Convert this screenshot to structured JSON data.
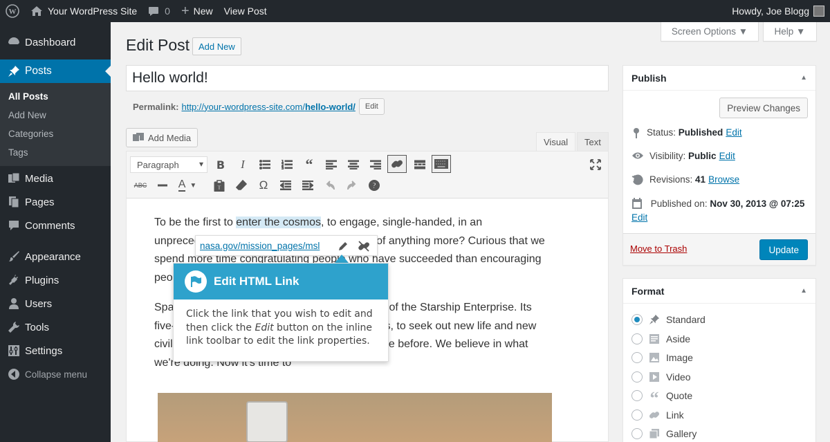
{
  "adminbar": {
    "site_name": "Your WordPress Site",
    "comments_count": "0",
    "new_label": "New",
    "view_post": "View Post",
    "howdy": "Howdy, Joe Blogg"
  },
  "sidebar": {
    "dashboard": "Dashboard",
    "posts": "Posts",
    "submenu": [
      "All Posts",
      "Add New",
      "Categories",
      "Tags"
    ],
    "media": "Media",
    "pages": "Pages",
    "comments": "Comments",
    "appearance": "Appearance",
    "plugins": "Plugins",
    "users": "Users",
    "tools": "Tools",
    "settings": "Settings",
    "collapse": "Collapse menu"
  },
  "screen_meta": {
    "screen_options": "Screen Options ▼",
    "help": "Help ▼"
  },
  "header": {
    "title": "Edit Post",
    "add_new": "Add New"
  },
  "post": {
    "title": "Hello world!",
    "permalink_label": "Permalink:",
    "permalink_base": "http://your-wordpress-site.com/",
    "permalink_slug": "hello-world/",
    "edit_slug": "Edit"
  },
  "editor": {
    "add_media": "Add Media",
    "tab_visual": "Visual",
    "tab_text": "Text",
    "format": "Paragraph",
    "p1_before": "To be the first to ",
    "p1_link": "enter the cosmos",
    "p1_after": ", to engage, single-handed, in an unprecedented battle... Could anyone dream of anything more? Curious that we spend more time congratulating people who have succeeded than encouraging people who have not.",
    "p2": "Space, the final frontier. These are the voyages of the Starship Enterprise. Its five-year mission: to explore strange new worlds, to seek out new life and new civilizations, to boldly go where no man has gone before. We believe in what we're doing. Now it's time to"
  },
  "link_toolbar": {
    "url": "nasa.gov/mission_pages/msl"
  },
  "pointer": {
    "title": "Edit HTML Link",
    "body_1": "Click the link that you wish to edit and then click the ",
    "body_em": "Edit",
    "body_2": " button on the inline link toolbar to edit the link properties."
  },
  "publish": {
    "title": "Publish",
    "preview": "Preview Changes",
    "status_label": "Status:",
    "status_value": "Published",
    "visibility_label": "Visibility:",
    "visibility_value": "Public",
    "revisions_label": "Revisions:",
    "revisions_value": "41",
    "browse": "Browse",
    "published_label": "Published on:",
    "published_value": "Nov 30, 2013 @ 07:25",
    "edit": "Edit",
    "trash": "Move to Trash",
    "update": "Update"
  },
  "format_box": {
    "title": "Format",
    "options": [
      "Standard",
      "Aside",
      "Image",
      "Video",
      "Quote",
      "Link",
      "Gallery"
    ],
    "selected": "Standard"
  },
  "colors": {
    "accent": "#0073aa",
    "adminbar": "#23282d",
    "pointer": "#2ea2cc",
    "update": "#0085ba"
  }
}
